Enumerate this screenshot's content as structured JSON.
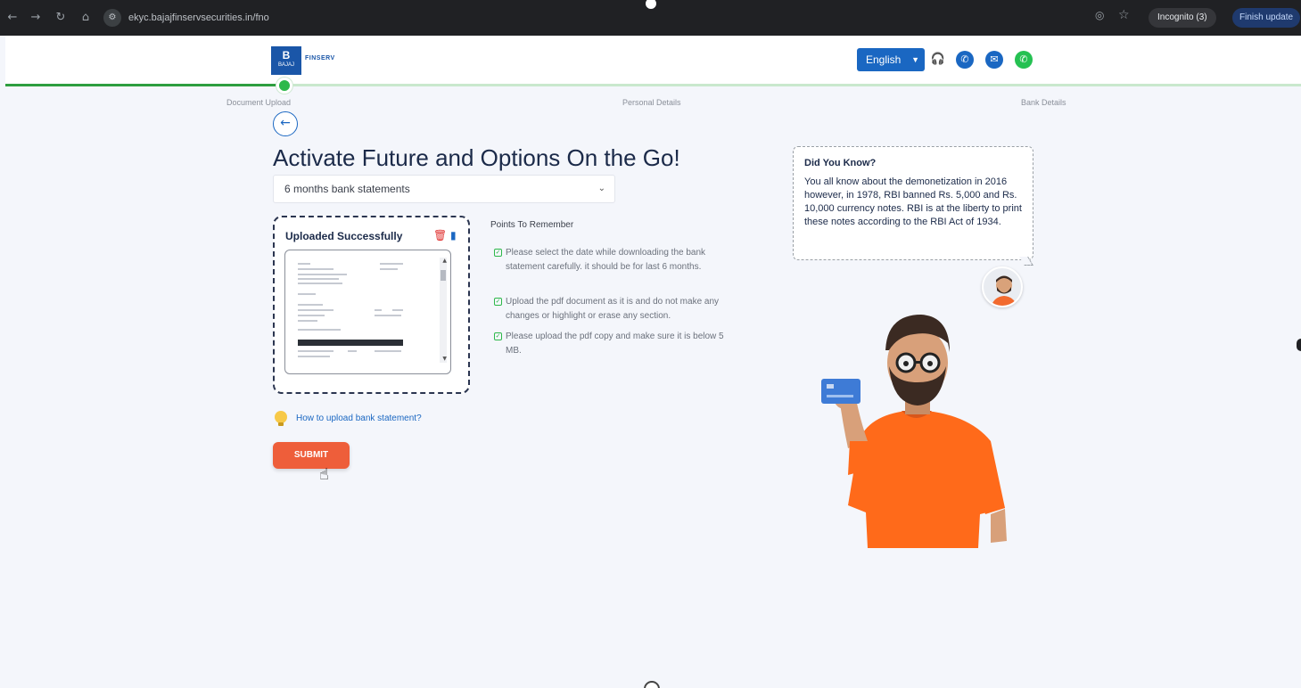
{
  "browser": {
    "url": "ekyc.bajajfinservsecurities.in/fno",
    "incognito_label": "Incognito (3)",
    "finish_update_label": "Finish update"
  },
  "header": {
    "logo_letter": "B",
    "logo_sub": "BAJAJ",
    "logo_text": "FINSERV",
    "language": "English",
    "icons": [
      "headset-icon",
      "phone-icon",
      "mail-icon",
      "whatsapp-icon"
    ],
    "brand_color": "#1a67c2"
  },
  "progress": {
    "steps": [
      "Document Upload",
      "Personal Details",
      "Bank Details"
    ],
    "current_step": 1,
    "done_color": "#2e9e3f"
  },
  "main": {
    "title": "Activate Future and Options On the Go!",
    "document_type": "6 months bank statements",
    "upload": {
      "status": "Uploaded Successfully"
    },
    "points_title": "Points To Remember",
    "points": [
      "Please select the date while downloading the bank statement carefully. it should be for last 6 months.",
      "Upload the pdf document as it is and do not make any changes or highlight or erase any section.",
      "Please upload the pdf copy and make sure it is below 5 MB."
    ],
    "howto_link": "How to upload bank statement?",
    "submit_label": "SUBMIT",
    "submit_color": "#ee5e3a"
  },
  "did_you_know": {
    "title": "Did You Know?",
    "body": "You all know about the demonetization in 2016 however, in 1978, RBI banned Rs. 5,000 and Rs. 10,000 currency notes. RBI is at the liberty to print these notes according to the RBI Act of 1934."
  }
}
